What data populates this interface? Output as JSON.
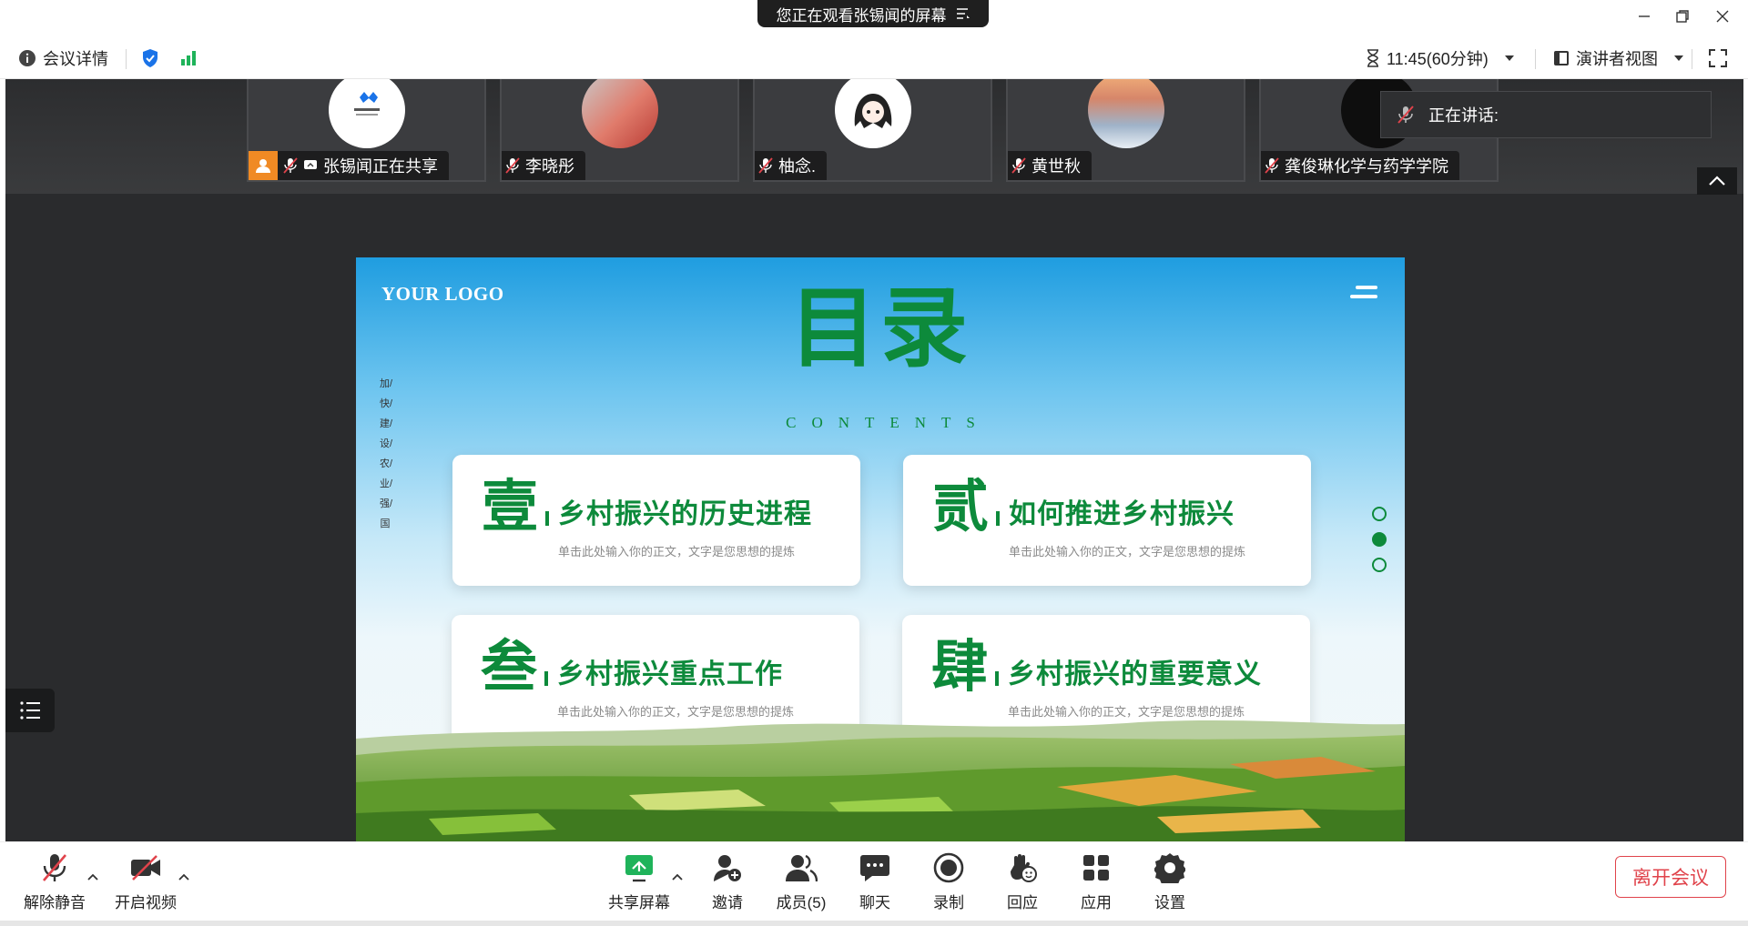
{
  "window": {
    "share_banner": "您正在观看张锡闻的屏幕"
  },
  "infobar": {
    "meeting_details": "会议详情",
    "timer": "11:45(60分钟)",
    "view_mode": "演讲者视图"
  },
  "participants": [
    {
      "name": "张锡闻正在共享",
      "sharing": true,
      "muted": true
    },
    {
      "name": "李晓彤",
      "sharing": false,
      "muted": true
    },
    {
      "name": "柚念.",
      "sharing": false,
      "muted": true
    },
    {
      "name": "黄世秋",
      "sharing": false,
      "muted": true
    },
    {
      "name": "龚俊琳化学与药学学院",
      "sharing": false,
      "muted": true
    }
  ],
  "speaking": {
    "label": "正在讲话:"
  },
  "slide": {
    "logo": "YOUR LOGO",
    "title": "目录",
    "subtitle": "CONTENTS",
    "vertical_text": "加/快/建/设/农/业/强/国",
    "items": [
      {
        "num": "壹",
        "title": "乡村振兴的历史进程",
        "desc": "单击此处输入你的正文，文字是您思想的提炼"
      },
      {
        "num": "贰",
        "title": "如何推进乡村振兴",
        "desc": "单击此处输入你的正文，文字是您思想的提炼"
      },
      {
        "num": "叁",
        "title": "乡村振兴重点工作",
        "desc": "单击此处输入你的正文，文字是您思想的提炼"
      },
      {
        "num": "肆",
        "title": "乡村振兴的重要意义",
        "desc": "单击此处输入你的正文，文字是您思想的提炼"
      }
    ],
    "active_page": 2,
    "page_count": 3
  },
  "toolbar": {
    "unmute": "解除静音",
    "start_video": "开启视频",
    "share_screen": "共享屏幕",
    "invite": "邀请",
    "members": "成员(5)",
    "chat": "聊天",
    "record": "录制",
    "react": "回应",
    "apps": "应用",
    "settings": "设置",
    "leave": "离开会议"
  },
  "colors": {
    "accent_green": "#0d8a3b",
    "leave_red": "#e0434b",
    "share_orange": "#f08a24",
    "shield_blue": "#1a73e8"
  }
}
